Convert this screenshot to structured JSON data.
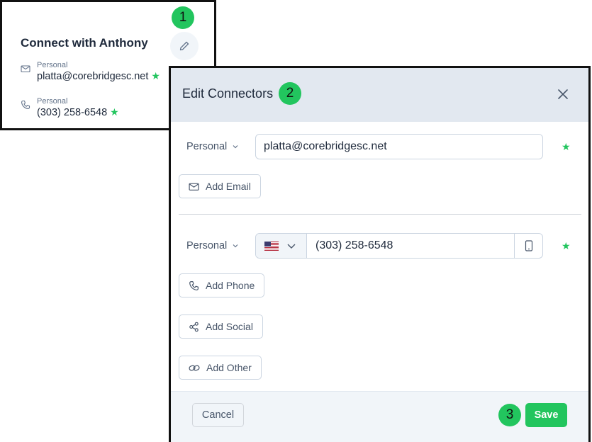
{
  "connect_card": {
    "title": "Connect with Anthony",
    "email": {
      "label": "Personal",
      "value": "platta@corebridgesc.net"
    },
    "phone": {
      "label": "Personal",
      "value": "(303) 258-6548"
    }
  },
  "steps": [
    "1",
    "2",
    "3"
  ],
  "modal": {
    "title": "Edit Connectors",
    "email_section": {
      "type": "Personal",
      "value": "platta@corebridgesc.net",
      "add_label": "Add Email"
    },
    "phone_section": {
      "type": "Personal",
      "country": "US",
      "value": "(303) 258-6548",
      "add_label": "Add Phone"
    },
    "add_social_label": "Add Social",
    "add_other_label": "Add Other",
    "cancel_label": "Cancel",
    "save_label": "Save"
  },
  "colors": {
    "accent": "#22c55e",
    "header_bg": "#e2e8f0",
    "footer_bg": "#f1f5f9",
    "text": "#1e293b"
  },
  "icons": [
    "pencil-icon",
    "mail-icon",
    "phone-icon",
    "star-icon",
    "close-icon",
    "chevron-down-icon",
    "us-flag-icon",
    "mobile-device-icon",
    "share-icon",
    "link-icon"
  ]
}
